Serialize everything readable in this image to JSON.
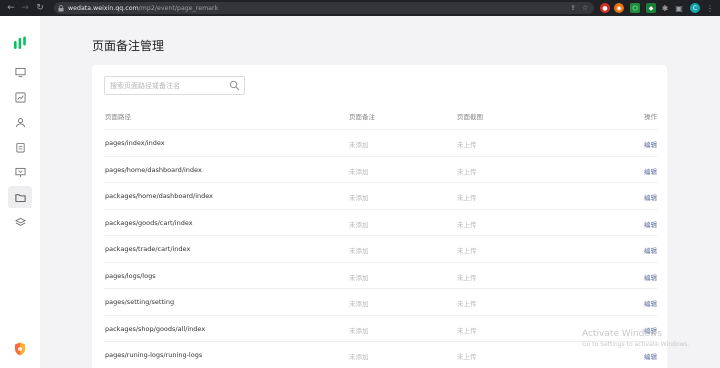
{
  "browser": {
    "url_domain": "wedata.weixin.qq.com",
    "url_path": "/mp2/event/page_remark"
  },
  "page": {
    "title": "页面备注管理"
  },
  "search": {
    "placeholder": "搜索页面路径或备注名"
  },
  "table": {
    "headers": [
      "页面路径",
      "页面备注",
      "页面截图",
      "操作"
    ],
    "rows": [
      {
        "path": "pages/index/index",
        "remark": "未添加",
        "screenshot": "未上传",
        "action": "编辑"
      },
      {
        "path": "pages/home/dashboard/index",
        "remark": "未添加",
        "screenshot": "未上传",
        "action": "编辑"
      },
      {
        "path": "packages/home/dashboard/index",
        "remark": "未添加",
        "screenshot": "未上传",
        "action": "编辑"
      },
      {
        "path": "packages/goods/cart/index",
        "remark": "未添加",
        "screenshot": "未上传",
        "action": "编辑"
      },
      {
        "path": "packages/trade/cart/index",
        "remark": "未添加",
        "screenshot": "未上传",
        "action": "编辑"
      },
      {
        "path": "pages/logs/logs",
        "remark": "未添加",
        "screenshot": "未上传",
        "action": "编辑"
      },
      {
        "path": "pages/setting/setting",
        "remark": "未添加",
        "screenshot": "未上传",
        "action": "编辑"
      },
      {
        "path": "packages/shop/goods/all/index",
        "remark": "未添加",
        "screenshot": "未上传",
        "action": "编辑"
      },
      {
        "path": "pages/runing-logs/runing-logs",
        "remark": "未添加",
        "screenshot": "未上传",
        "action": "编辑"
      }
    ]
  },
  "watermark": {
    "line1": "Activate Windows",
    "line2": "Go to Settings to activate Windows."
  },
  "colors": {
    "accent": "#07c160",
    "link": "#5a6b9e"
  }
}
